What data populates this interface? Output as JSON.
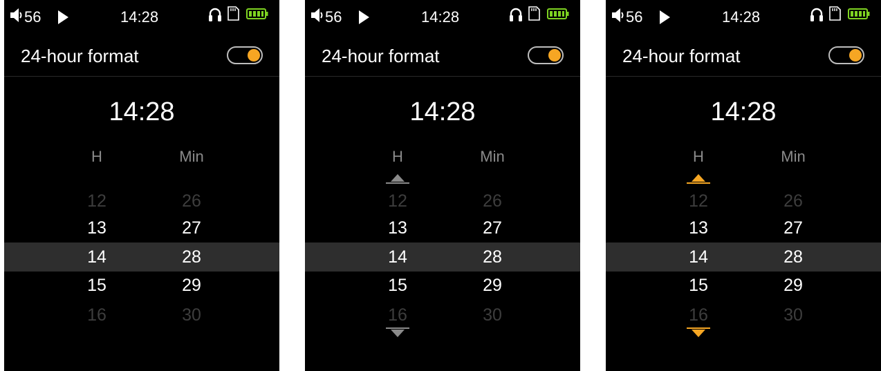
{
  "status": {
    "volume": "56",
    "time": "14:28"
  },
  "setting": {
    "label": "24-hour format",
    "enabled": true
  },
  "display_time": "14:28",
  "columns": {
    "hour": "H",
    "minute": "Min"
  },
  "hours": [
    "12",
    "13",
    "14",
    "15",
    "16"
  ],
  "minutes": [
    "26",
    "27",
    "28",
    "29",
    "30"
  ],
  "colors": {
    "accent": "#f6a623",
    "background": "#000000",
    "selection_band": "#2e2e2e",
    "muted": "#8a8a8a",
    "faint": "#3d3d3d"
  },
  "screens": [
    {
      "state": "browsing",
      "hour_arrows": "none"
    },
    {
      "state": "hour-column-highlighted",
      "hour_arrows": "gray"
    },
    {
      "state": "hour-column-editing",
      "hour_arrows": "orange"
    }
  ]
}
